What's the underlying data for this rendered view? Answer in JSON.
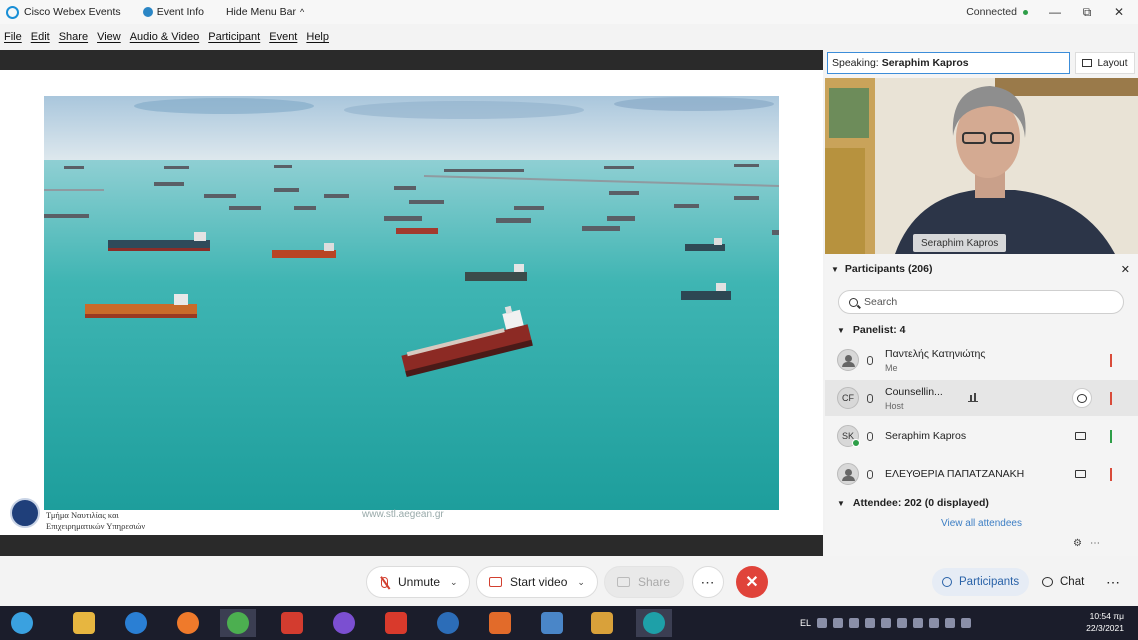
{
  "window": {
    "title": "Cisco Webex Events",
    "event_info": "Event Info",
    "hide_menu_bar": "Hide Menu Bar",
    "status": "Connected"
  },
  "menu": [
    "File",
    "Edit",
    "Share",
    "View",
    "Audio & Video",
    "Participant",
    "Event",
    "Help"
  ],
  "slide": {
    "footer_text": "Τμήμα Ναυτιλίας και Επιχειρηματικών Υπηρεσιών",
    "footer_url": "www.stl.aegean.gr"
  },
  "speaking": {
    "label": "Speaking:",
    "name": "Seraphim Kapros"
  },
  "layout_button": "Layout",
  "video": {
    "name_label": "Seraphim Kapros"
  },
  "participants": {
    "header": "Participants (206)",
    "search_placeholder": "Search",
    "panelist_section": "Panelist: 4",
    "attendee_section": "Attendee: 202 (0 displayed)",
    "view_all": "View all attendees",
    "panelists": [
      {
        "name": "Παντελής Κατηνιώτης",
        "role": "Me",
        "initials": ""
      },
      {
        "name": "Counsellin...",
        "role": "Host",
        "initials": "CF"
      },
      {
        "name": "Seraphim Kapros",
        "role": "",
        "initials": "SK"
      },
      {
        "name": "ΕΛΕΥΘΕΡΙΑ ΠΑΠΑΤΖΑΝΑΚΗ",
        "role": "",
        "initials": ""
      }
    ]
  },
  "controls": {
    "unmute": "Unmute",
    "start_video": "Start video",
    "share": "Share",
    "participants": "Participants",
    "chat": "Chat"
  },
  "taskbar": {
    "lang": "EL",
    "time": "10:54 πμ",
    "date": "22/3/2021"
  },
  "colors": {
    "accent": "#2962a8",
    "leave": "#e0433a",
    "mute_red": "#d23f2f",
    "speaking_border": "#3c8dd9"
  }
}
